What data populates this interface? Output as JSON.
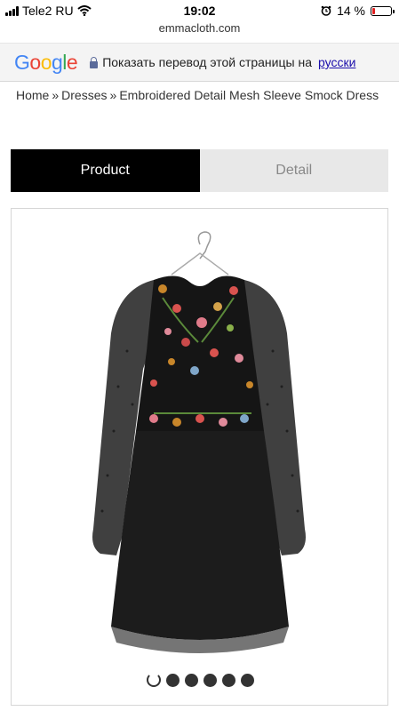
{
  "status_bar": {
    "carrier": "Tele2 RU",
    "time": "19:02",
    "battery_percent": "14 %",
    "battery_level": 0.14,
    "battery_color": "#e02020"
  },
  "browser": {
    "url": "emmacloth.com"
  },
  "translate_bar": {
    "logo_letters": [
      "G",
      "o",
      "o",
      "g",
      "l",
      "e"
    ],
    "message": "Показать перевод этой страницы на",
    "language_link": "русски"
  },
  "breadcrumb": {
    "items": [
      "Home",
      "Dresses",
      "Embroidered Detail Mesh Sleeve Smock Dress"
    ],
    "separator": "»"
  },
  "tabs": [
    {
      "label": "Product",
      "active": true
    },
    {
      "label": "Detail",
      "active": false
    }
  ],
  "gallery": {
    "image_alt": "Embroidered Detail Mesh Sleeve Smock Dress",
    "dot_count": 6,
    "active_index": 0
  },
  "colors": {
    "tab_active_bg": "#000000",
    "tab_inactive_bg": "#e8e8e8",
    "link": "#1a0dab"
  },
  "icons": [
    "signal-icon",
    "wifi-icon",
    "alarm-icon",
    "battery-icon",
    "lock-icon"
  ]
}
